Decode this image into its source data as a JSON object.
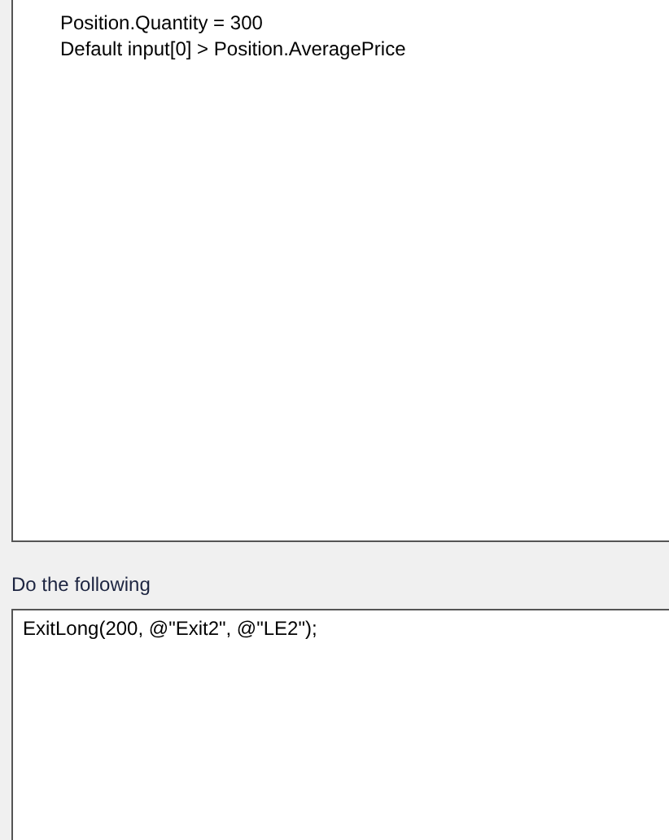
{
  "conditions_box": {
    "lines": [
      "Position.Quantity = 300",
      "Default input[0] > Position.AveragePrice"
    ]
  },
  "actions_label": "Do the following",
  "actions_box": {
    "lines": [
      "ExitLong(200, @\"Exit2\", @\"LE2\");"
    ]
  }
}
